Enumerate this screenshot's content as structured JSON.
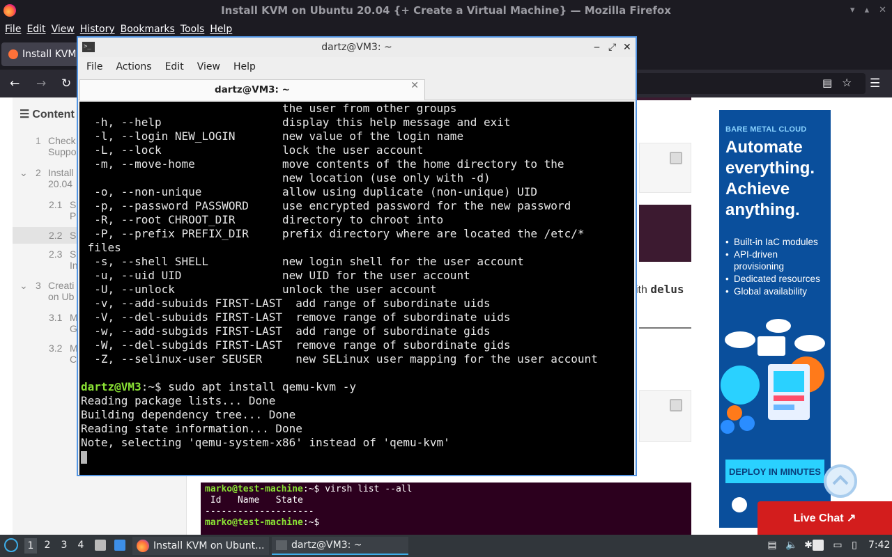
{
  "firefox": {
    "title": "Install KVM on Ubuntu 20.04 {+ Create a Virtual Machine} — Mozilla Firefox",
    "menu": [
      "File",
      "Edit",
      "View",
      "History",
      "Bookmarks",
      "Tools",
      "Help"
    ],
    "tab_label": "Install KVM"
  },
  "toc": {
    "heading": "Content",
    "items": [
      {
        "num": "1",
        "text": "Check\nSuppo"
      },
      {
        "num": "2",
        "text": "Install\n20.04"
      },
      {
        "num": "2.1",
        "text": "S\nP"
      },
      {
        "num": "2.2",
        "text": "S"
      },
      {
        "num": "2.3",
        "text": "S\nIn"
      },
      {
        "num": "3",
        "text": "Creati\non Ub"
      },
      {
        "num": "3.1",
        "text": "M\nG"
      },
      {
        "num": "3.2",
        "text": "M\nC"
      }
    ]
  },
  "article": {
    "delus_prefix": "ith ",
    "delus_code": "delus",
    "terminal2_lines": [
      {
        "prompt": "marko@test-machine",
        "rest": ":~$ virsh list --all"
      },
      {
        "prompt": "",
        "rest": " Id   Name   State"
      },
      {
        "prompt": "",
        "rest": "--------------------"
      },
      {
        "prompt": "",
        "rest": ""
      },
      {
        "prompt": "marko@test-machine",
        "rest": ":~$"
      }
    ]
  },
  "ad": {
    "label": "BARE METAL CLOUD",
    "headline": "Automate everything. Achieve anything.",
    "bullets": [
      "Built-in IaC modules",
      "API-driven provisioning",
      "Dedicated resources",
      "Global availability"
    ],
    "cta": "DEPLOY IN MINUTES"
  },
  "livechat": "Live Chat ↗",
  "terminal": {
    "title": "dartz@VM3: ~",
    "menu": [
      "File",
      "Actions",
      "Edit",
      "View",
      "Help"
    ],
    "tab_label": "dartz@VM3: ~",
    "lines": [
      {
        "t": "                              the user from other groups"
      },
      {
        "t": "  -h, --help                  display this help message and exit"
      },
      {
        "t": "  -l, --login NEW_LOGIN       new value of the login name"
      },
      {
        "t": "  -L, --lock                  lock the user account"
      },
      {
        "t": "  -m, --move-home             move contents of the home directory to the"
      },
      {
        "t": "                              new location (use only with -d)"
      },
      {
        "t": "  -o, --non-unique            allow using duplicate (non-unique) UID"
      },
      {
        "t": "  -p, --password PASSWORD     use encrypted password for the new password"
      },
      {
        "t": "  -R, --root CHROOT_DIR       directory to chroot into"
      },
      {
        "t": "  -P, --prefix PREFIX_DIR     prefix directory where are located the /etc/*"
      },
      {
        "t": " files"
      },
      {
        "t": "  -s, --shell SHELL           new login shell for the user account"
      },
      {
        "t": "  -u, --uid UID               new UID for the user account"
      },
      {
        "t": "  -U, --unlock                unlock the user account"
      },
      {
        "t": "  -v, --add-subuids FIRST-LAST  add range of subordinate uids"
      },
      {
        "t": "  -V, --del-subuids FIRST-LAST  remove range of subordinate uids"
      },
      {
        "t": "  -w, --add-subgids FIRST-LAST  add range of subordinate gids"
      },
      {
        "t": "  -W, --del-subgids FIRST-LAST  remove range of subordinate gids"
      },
      {
        "t": "  -Z, --selinux-user SEUSER     new SELinux user mapping for the user account"
      },
      {
        "t": ""
      },
      {
        "p": "dartz@VM3",
        "t": ":~$ sudo apt install qemu-kvm -y"
      },
      {
        "t": "Reading package lists... Done"
      },
      {
        "t": "Building dependency tree... Done"
      },
      {
        "t": "Reading state information... Done"
      },
      {
        "t": "Note, selecting 'qemu-system-x86' instead of 'qemu-kvm'"
      }
    ]
  },
  "taskbar": {
    "workspaces": [
      "1",
      "2",
      "3",
      "4"
    ],
    "task1": "Install KVM on Ubunt...",
    "task2": "dartz@VM3: ~",
    "clock": "7:42"
  }
}
